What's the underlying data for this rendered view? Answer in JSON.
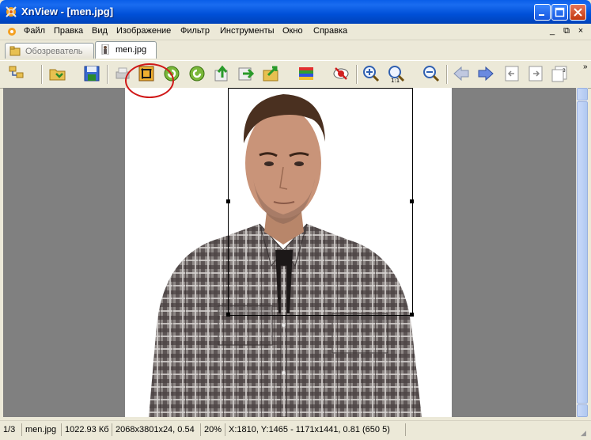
{
  "window": {
    "title": "XnView - [men.jpg]"
  },
  "menu": {
    "items": [
      "Файл",
      "Правка",
      "Вид",
      "Изображение",
      "Фильтр",
      "Инструменты",
      "Окно",
      "Справка"
    ],
    "mdi_controls": [
      "_",
      "⧉",
      "×"
    ]
  },
  "tabs": [
    {
      "label": "Обозреватель",
      "active": false
    },
    {
      "label": "men.jpg",
      "active": true
    }
  ],
  "toolbar": {
    "icons": [
      "browser-icon",
      "open-folder-icon",
      "save-icon",
      "print-icon",
      "crop-icon",
      "rotate-left-icon",
      "rotate-right-icon",
      "export-icon",
      "convert-icon",
      "batch-icon",
      "adjust-colors-icon",
      "red-eye-icon",
      "zoom-in-icon",
      "zoom-1to1-icon",
      "zoom-out-icon",
      "previous-icon",
      "next-icon",
      "first-page-icon",
      "last-page-icon",
      "page-icon"
    ]
  },
  "status": {
    "index": "1/3",
    "filename": "men.jpg",
    "filesize": "1022.93 Кб",
    "dimensions": "2068x3801x24, 0.54",
    "zoom": "20%",
    "coords": "X:1810, Y:1465 - 1171x1441, 0.81 (650 5)"
  },
  "colors": {
    "titlebar": "#0050d8",
    "highlight": "#d01818"
  }
}
